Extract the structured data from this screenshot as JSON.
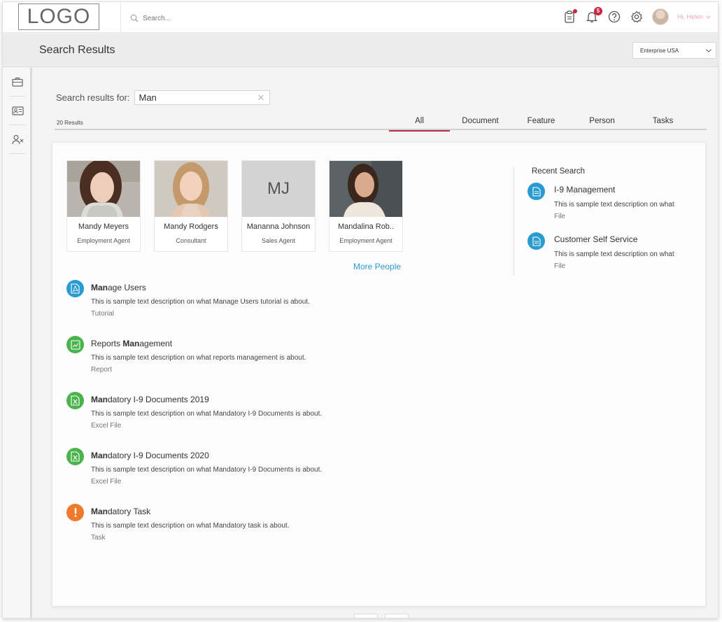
{
  "header": {
    "logo": "LOGO",
    "search_placeholder": "Search...",
    "notification_count": "5",
    "greeting": "Hi, Helen"
  },
  "titlebar": {
    "title": "Search Results",
    "company": "Enterprise USA"
  },
  "search": {
    "label": "Search results for:",
    "query": "Man",
    "results_count": "20 Results"
  },
  "tabs": [
    "All",
    "Document",
    "Feature",
    "Person",
    "Tasks"
  ],
  "people": [
    {
      "name": "Mandy Meyers",
      "role": "Employment Agent",
      "initials": ""
    },
    {
      "name": "Mandy Rodgers",
      "role": "Consultant",
      "initials": ""
    },
    {
      "name": "Mananna Johnson",
      "role": "Sales Agent",
      "initials": "MJ"
    },
    {
      "name": "Mandalina Rob..",
      "role": "Employment Agent",
      "initials": ""
    }
  ],
  "more_people": "More People",
  "results": [
    {
      "bold": "Man",
      "rest": "age Users",
      "desc": "This is sample text description on what Manage Users tutorial is about.",
      "type": "Tutorial",
      "icon": "pdf-icon",
      "color": "#2a9bd1"
    },
    {
      "pre": "Reports ",
      "bold": "Man",
      "rest": "agement",
      "desc": "This is sample text description on what reports management is about.",
      "type": "Report",
      "icon": "chart-icon",
      "color": "#4bb34b"
    },
    {
      "bold": "Man",
      "rest": "datory I-9 Documents 2019",
      "desc": "This is sample text description on what Mandatory I-9 Documents is about.",
      "type": "Excel File",
      "icon": "excel-icon",
      "color": "#4bb34b"
    },
    {
      "bold": "Man",
      "rest": "datory I-9 Documents 2020",
      "desc": "This is sample text description on what Mandatory I-9 Documents is about.",
      "type": "Excel File",
      "icon": "excel-icon",
      "color": "#4bb34b"
    },
    {
      "bold": "Man",
      "rest": "datory Task",
      "desc": "This is sample text description on what Mandatory task is about.",
      "type": "Task",
      "icon": "alert-icon",
      "color": "#f07a2c"
    }
  ],
  "recent": {
    "title": "Recent Search",
    "items": [
      {
        "title": "I-9 Management",
        "desc": "This is sample text description on what",
        "type": "File"
      },
      {
        "title": "Customer Self Service",
        "desc": "This is sample text description on what",
        "type": "File"
      }
    ]
  }
}
